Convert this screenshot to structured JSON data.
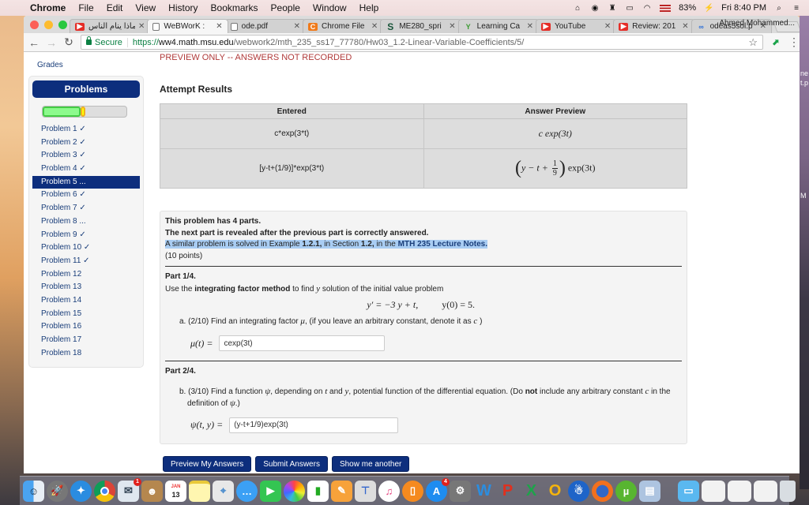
{
  "menubar": {
    "app": "Chrome",
    "items": [
      "File",
      "Edit",
      "View",
      "History",
      "Bookmarks",
      "People",
      "Window",
      "Help"
    ],
    "battery": "83%",
    "clock": "Fri 8:40 PM"
  },
  "browser": {
    "tabs": [
      {
        "title": "لماذا ينام الناس",
        "icon": "youtube-icon",
        "active": false
      },
      {
        "title": "WeBWorK : ",
        "icon": "page-icon",
        "active": true
      },
      {
        "title": "ode.pdf",
        "icon": "page-icon",
        "active": false
      },
      {
        "title": "Chrome File",
        "icon": "c-icon",
        "active": false
      },
      {
        "title": "ME280_spri",
        "icon": "s-icon",
        "active": false
      },
      {
        "title": "Learning Ca",
        "icon": "learning-icon",
        "active": false
      },
      {
        "title": "YouTube",
        "icon": "youtube-icon",
        "active": false
      },
      {
        "title": "Review: 201",
        "icon": "youtube-icon",
        "active": false
      },
      {
        "title": "odeas5sol.p",
        "icon": "link-icon",
        "active": false
      }
    ],
    "profile": "Ahmed Mohammed...",
    "secure_label": "Secure",
    "url_scheme": "https://",
    "url_host": "ww4.math.msu.edu",
    "url_path": "/webwork2/mth_235_ss17_77780/Hw03_1.2-Linear-Variable-Coefficients/5/"
  },
  "page": {
    "grades_link": "Grades",
    "preview_note": "PREVIEW ONLY -- ANSWERS NOT RECORDED",
    "sidebar": {
      "title": "Problems",
      "progress": {
        "correct_fraction": 0.45,
        "partial_fraction": 0.06
      },
      "problems": [
        {
          "label": "Problem 1 ✓"
        },
        {
          "label": "Problem 2 ✓"
        },
        {
          "label": "Problem 3 ✓"
        },
        {
          "label": "Problem 4 ✓"
        },
        {
          "label": "Problem 5 ...",
          "active": true
        },
        {
          "label": "Problem 6 ✓"
        },
        {
          "label": "Problem 7 ✓"
        },
        {
          "label": "Problem 8 ..."
        },
        {
          "label": "Problem 9 ✓"
        },
        {
          "label": "Problem 10 ✓"
        },
        {
          "label": "Problem 11 ✓"
        },
        {
          "label": "Problem 12"
        },
        {
          "label": "Problem 13"
        },
        {
          "label": "Problem 14"
        },
        {
          "label": "Problem 15"
        },
        {
          "label": "Problem 16"
        },
        {
          "label": "Problem 17"
        },
        {
          "label": "Problem 18"
        }
      ]
    },
    "attempt": {
      "title": "Attempt Results",
      "headers": [
        "Entered",
        "Answer Preview"
      ],
      "rows": [
        {
          "entered": "c*exp(3*t)",
          "preview_a": "c exp(3t)"
        },
        {
          "entered": "[y-t+(1/9)]*exp(3*t)",
          "preview_pre": "y − t +",
          "preview_num": "1",
          "preview_den": "9",
          "preview_post": "exp(3t)"
        }
      ]
    },
    "problem": {
      "parts_line": "This problem has 4 parts.",
      "reveal_line": "The next part is revealed after the previous part is correctly answered.",
      "similar_prefix": "A similar problem is solved in Example ",
      "example": "1.2.1,",
      "section_text": " in Section ",
      "section": "1.2,",
      "in_the": " in the ",
      "notes_link": "MTH 235 Lecture Notes.",
      "points": "(10 points)",
      "part1_title": "Part 1/4.",
      "part1_pre": "Use the ",
      "part1_method": "integrating factor method",
      "part1_post": " to find ",
      "part1_var": "y",
      "part1_end": " solution of the initial value problem",
      "equation": "y′ = −3 y + t,",
      "initial": "y(0) = 5.",
      "qa_text": "a. (2/10) Find an integrating factor ",
      "qa_var": "μ",
      "qa_end": ", (if you leave an arbitrary constant, denote it as ",
      "qa_c": "c",
      "qa_close": " )",
      "qa_label": "μ(t) =",
      "qa_value": "cexp(3t)",
      "part2_title": "Part 2/4.",
      "qb_text": "b. (3/10) Find a function ",
      "qb_var": "ψ",
      "qb_mid": ", depending on ",
      "qb_t": "t",
      "qb_and": " and ",
      "qb_y": "y",
      "qb_rest": ", potential function of the differential equation. (Do ",
      "qb_not": "not",
      "qb_rest2": " include any arbitrary constant ",
      "qb_c": "c",
      "qb_rest3": " in the",
      "qb_line2a": "definition of ",
      "qb_line2b": "ψ",
      "qb_line2c": ".)",
      "qb_label": "ψ(t, y) =",
      "qb_value": "(y-t+1/9)exp(3t)"
    },
    "buttons": {
      "preview": "Preview My Answers",
      "submit": "Submit Answers",
      "another": "Show me another"
    }
  },
  "desktop": {
    "label1": "ne",
    "label2": "t.p",
    "label3": "M"
  },
  "dock": {
    "calendar_month": "JAN",
    "calendar_day": "13",
    "mail_badge": "1",
    "appstore_badge": "4"
  }
}
